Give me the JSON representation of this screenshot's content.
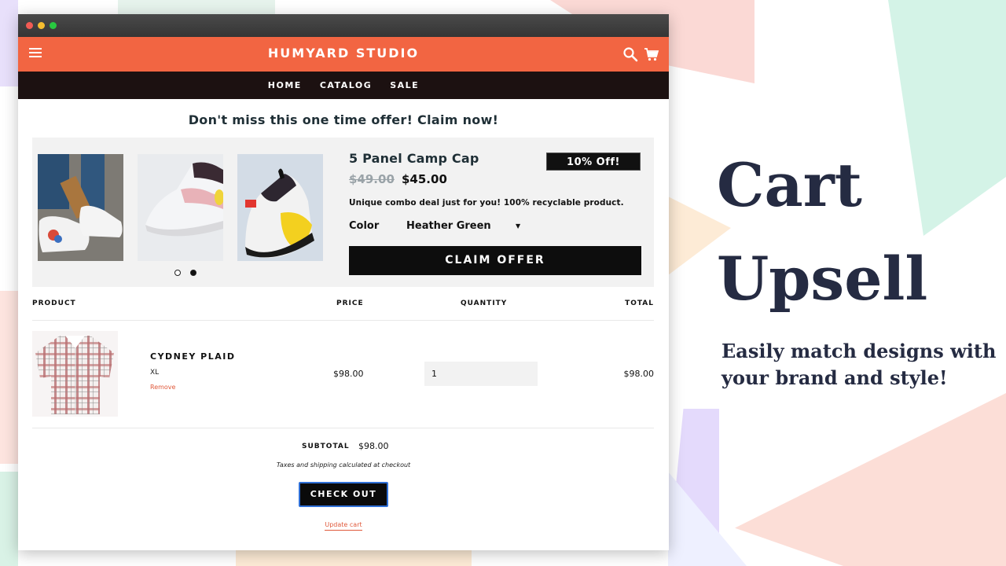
{
  "store": {
    "brand": "HUMYARD STUDIO",
    "nav": [
      "HOME",
      "CATALOG",
      "SALE"
    ]
  },
  "upsell": {
    "heading": "Don't miss this one time offer! Claim now!",
    "product_title": "5 Panel Camp Cap",
    "badge": "10% Off!",
    "old_price": "$49.00",
    "new_price": "$45.00",
    "description": "Unique combo deal just for you! 100% recyclable product.",
    "color_label": "Color",
    "color_value": "Heather Green",
    "claim_button": "CLAIM OFFER",
    "slide_count": 2,
    "active_slide": 2
  },
  "cart": {
    "headers": {
      "product": "PRODUCT",
      "price": "PRICE",
      "quantity": "QUANTITY",
      "total": "TOTAL"
    },
    "items": [
      {
        "name": "CYDNEY PLAID",
        "variant": "XL",
        "remove": "Remove",
        "price": "$98.00",
        "quantity": "1",
        "total": "$98.00"
      }
    ],
    "subtotal_label": "SUBTOTAL",
    "subtotal_value": "$98.00",
    "tax_note": "Taxes and shipping calculated at checkout",
    "checkout_button": "CHECK OUT",
    "update_cart": "Update cart"
  },
  "marketing": {
    "headline_line1": "Cart",
    "headline_line2": "Upsell",
    "tagline": "Easily match designs with your brand and style!"
  },
  "colors": {
    "header": "#f26542",
    "nav": "#1c1111",
    "accent_link": "#e0593b",
    "headline": "#252b42"
  },
  "icons": [
    "menu-icon",
    "search-icon",
    "cart-icon",
    "caret-down-icon"
  ]
}
